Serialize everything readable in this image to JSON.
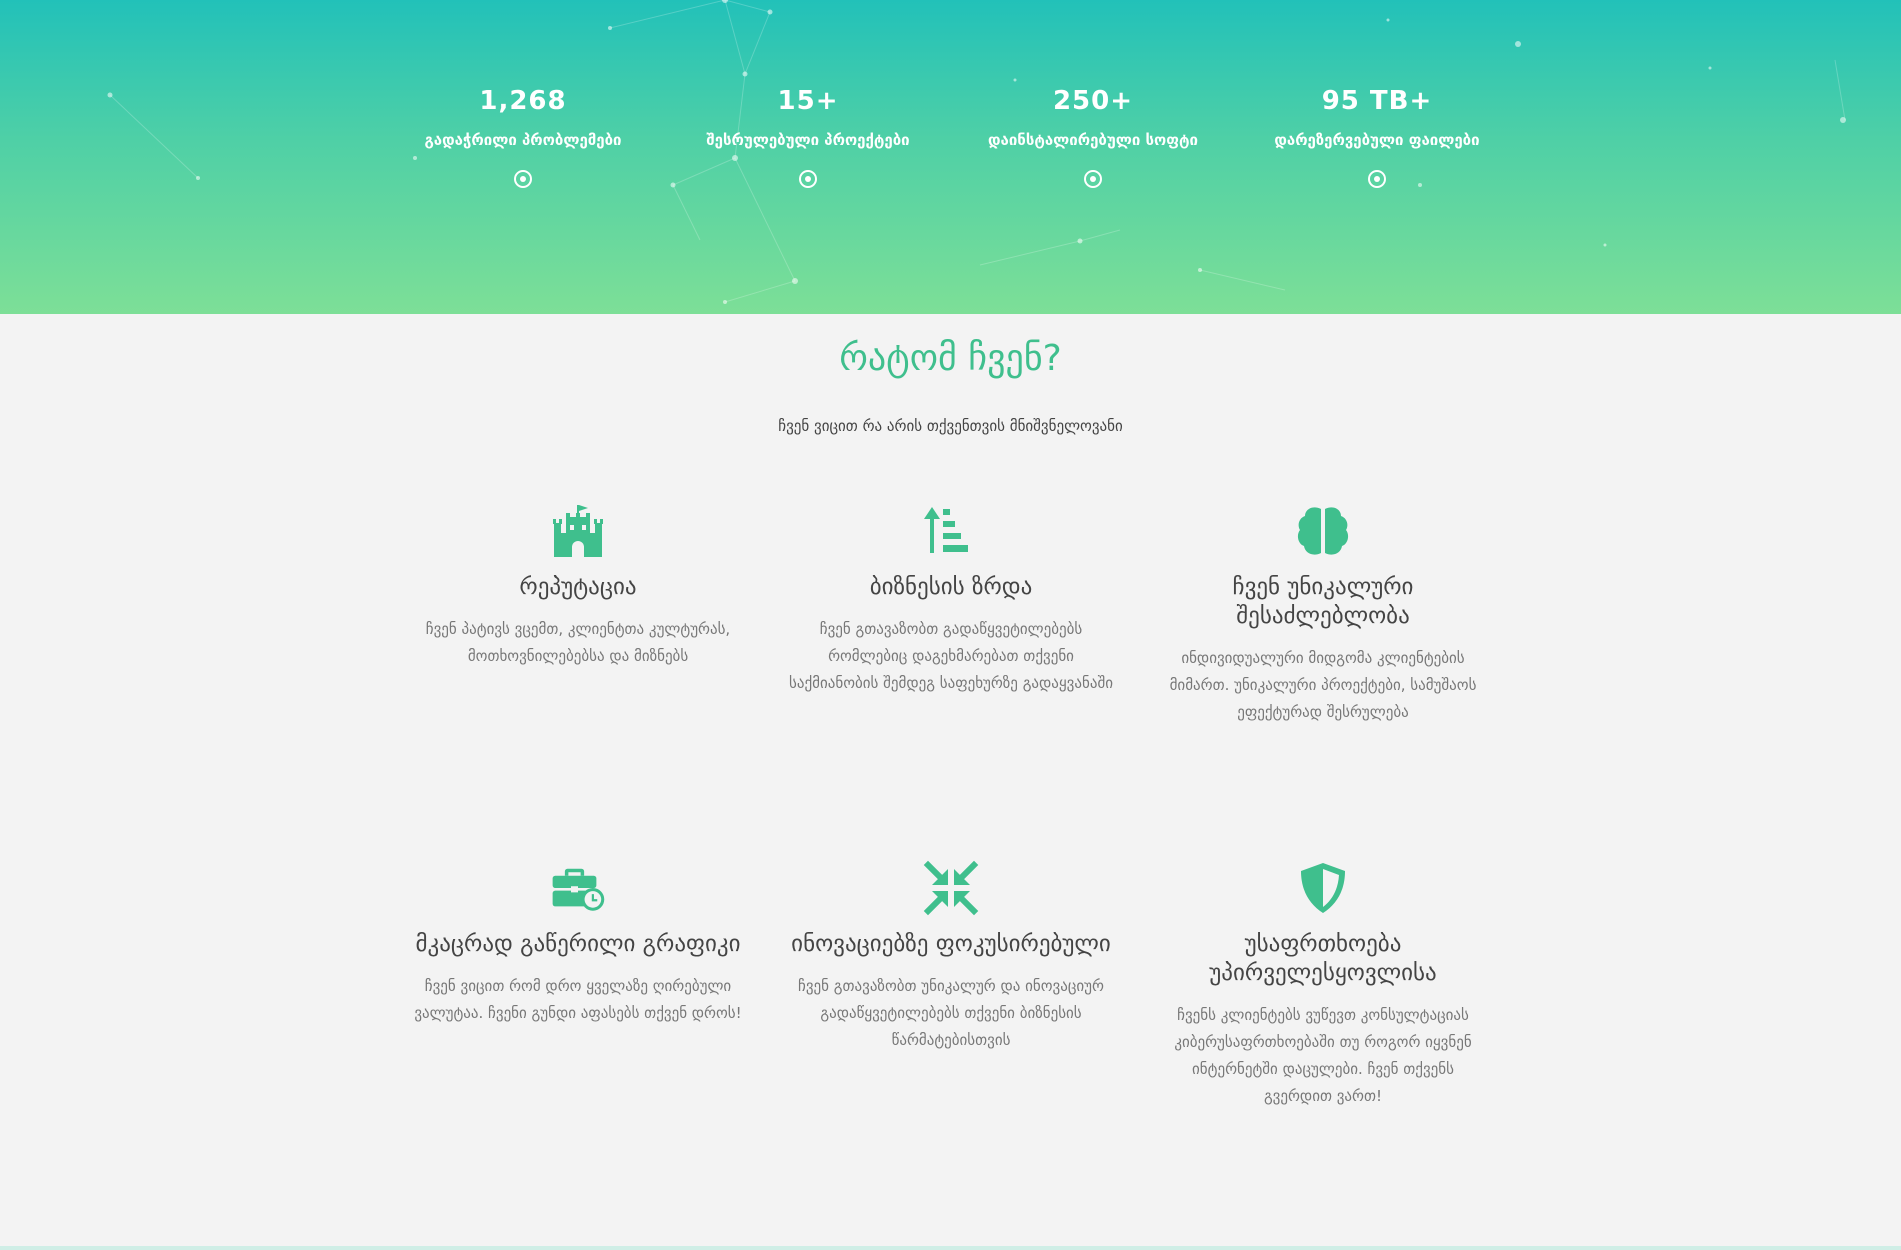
{
  "stats": [
    {
      "value": "1,268",
      "label": "გადაჭრილი პრობლემები",
      "icon": "target-icon"
    },
    {
      "value": "15+",
      "label": "შესრულებული პროექტები",
      "icon": "target-icon"
    },
    {
      "value": "250+",
      "label": "დაინსტალირებული სოფტი",
      "icon": "target-icon"
    },
    {
      "value": "95 TB+",
      "label": "დარეზერვებული ფაილები",
      "icon": "target-icon"
    }
  ],
  "why": {
    "title": "რატომ ჩვენ?",
    "subtitle": "ჩვენ ვიცით რა არის თქვენთვის მნიშვნელოვანი"
  },
  "features": [
    {
      "icon": "castle-icon",
      "title": "რეპუტაცია",
      "text": "ჩვენ პატივს ვცემთ, კლიენტთა კულტურას, მოთხოვნილებებსა და მიზნებს"
    },
    {
      "icon": "sort-growth-icon",
      "title": "ბიზნესის ზრდა",
      "text": "ჩვენ გთავაზობთ გადაწყვეტილებებს რომლებიც დაგეხმარებათ თქვენი საქმიანობის შემდეგ საფეხურზე გადაყვანაში"
    },
    {
      "icon": "brain-icon",
      "title": "ჩვენ უნიკალური შესაძლებლობა",
      "text": "ინდივიდუალური მიდგომა კლიენტების მიმართ. უნიკალური პროექტები, სამუშაოს ეფექტურად შესრულება"
    },
    {
      "icon": "briefcase-clock-icon",
      "title": "მკაცრად გაწერილი გრაფიკი",
      "text": "ჩვენ ვიცით რომ დრო ყველაზე ღირებული ვალუტაა. ჩვენი გუნდი აფასებს თქვენ დროს!"
    },
    {
      "icon": "compress-arrows-icon",
      "title": "ინოვაციებზე ფოკუსირებული",
      "text": "ჩვენ გთავაზობთ უნიკალურ და ინოვაციურ გადაწყვეტილებებს თქვენი ბიზნესის წარმატებისთვის"
    },
    {
      "icon": "shield-icon",
      "title": "უსაფრთხოება უპირველესყოვლისა",
      "text": "ჩვენს კლიენტებს ვუწევთ კონსულტაციას კიბერუსაფრთხოებაში თუ როგორ იყვნენ ინტერნეტში დაცულები. ჩვენ თქვენს გვერდით ვართ!"
    }
  ],
  "colors": {
    "accent": "#3fbf8d",
    "hero_top": "#22c1b9",
    "hero_bottom": "#7ddf97"
  }
}
